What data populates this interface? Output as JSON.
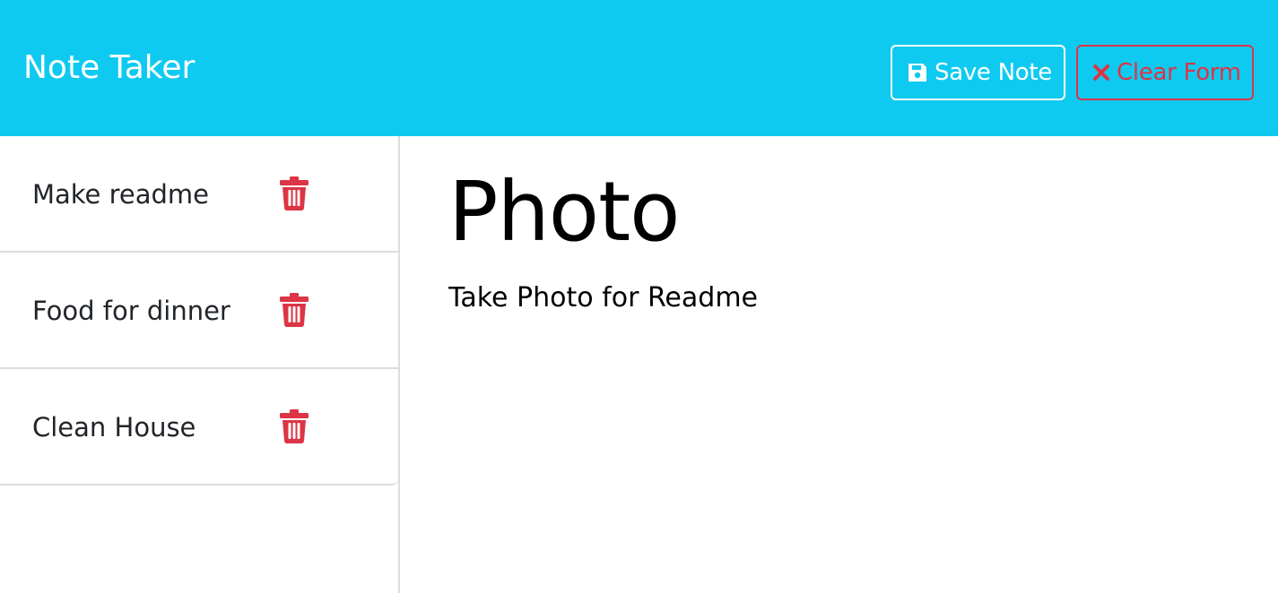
{
  "navbar": {
    "brand": "Note Taker",
    "save_label": "Save Note",
    "save_icon": "floppy-disk-icon",
    "clear_label": "Clear Form",
    "clear_icon": "x-mark-icon"
  },
  "notes": [
    {
      "title": "Make readme",
      "delete_icon": "trash-icon"
    },
    {
      "title": "Food for dinner",
      "delete_icon": "trash-icon"
    },
    {
      "title": "Clean House",
      "delete_icon": "trash-icon"
    }
  ],
  "editor": {
    "title_value": "Photo",
    "text_value": "Take Photo for Readme"
  },
  "colors": {
    "navbar_bg": "#0fcaf0",
    "danger": "#dc3545",
    "text": "#212529"
  }
}
